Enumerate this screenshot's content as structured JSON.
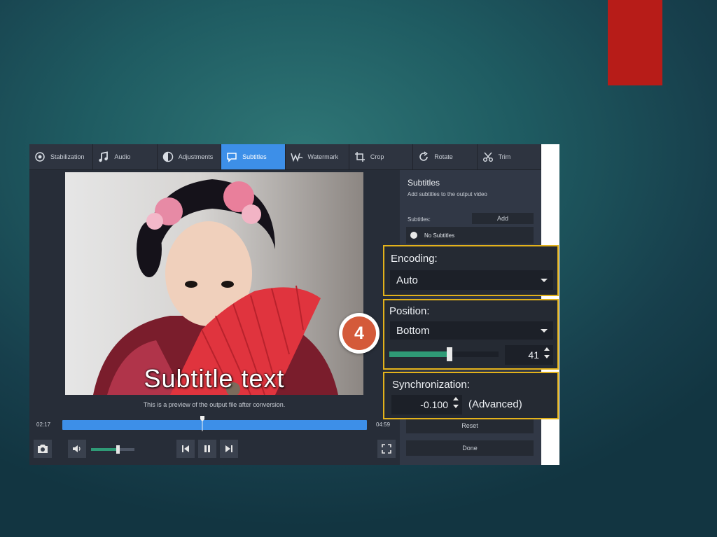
{
  "colors": {
    "accent": "#3d8fe8",
    "highlight": "#e3b21b",
    "slider": "#2f9a76",
    "badge": "#d45a3a",
    "slide_tab": "#b71c18"
  },
  "toolbar": {
    "tabs": [
      {
        "label": "Stabilization",
        "icon": "stabilization-icon"
      },
      {
        "label": "Audio",
        "icon": "music-note-icon"
      },
      {
        "label": "Adjustments",
        "icon": "contrast-icon"
      },
      {
        "label": "Subtitles",
        "icon": "speech-bubble-icon",
        "active": true
      },
      {
        "label": "Watermark",
        "icon": "watermark-icon"
      },
      {
        "label": "Crop",
        "icon": "crop-icon"
      },
      {
        "label": "Rotate",
        "icon": "rotate-icon"
      },
      {
        "label": "Trim",
        "icon": "scissors-icon"
      }
    ]
  },
  "preview": {
    "subtitle_text": "Subtitle text",
    "note": "This is a preview of the output file after conversion."
  },
  "player": {
    "time_current": "02:17",
    "time_total": "04:59",
    "progress_fraction": 0.46,
    "volume_fraction": 0.62
  },
  "side_panel": {
    "title": "Subtitles",
    "description": "Add subtitles to the output video",
    "subtitles_label": "Subtitles:",
    "add_label": "Add",
    "no_subtitles_label": "No Subtitles",
    "reset_label": "Reset",
    "done_label": "Done"
  },
  "encoding": {
    "label": "Encoding:",
    "value": "Auto"
  },
  "position": {
    "label": "Position:",
    "value": "Bottom",
    "offset": "41",
    "slider_fraction": 0.55
  },
  "synchronization": {
    "label": "Synchronization:",
    "value": "-0.100",
    "advanced_label": "(Advanced)"
  },
  "step_badge": "4"
}
